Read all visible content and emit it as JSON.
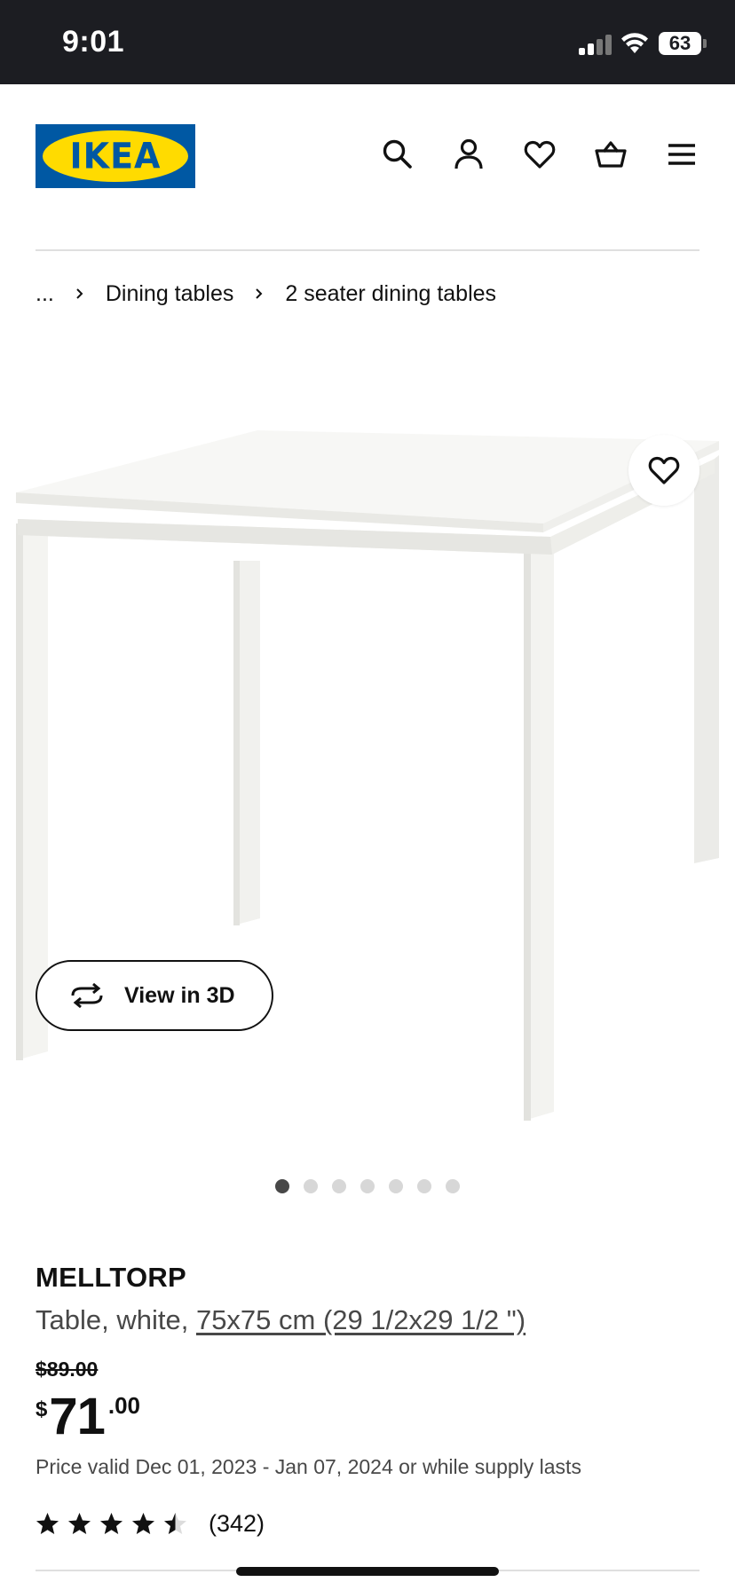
{
  "status_bar": {
    "time": "9:01",
    "battery": "63",
    "icons": [
      "cellular-signal-icon",
      "wifi-icon",
      "battery-icon"
    ]
  },
  "header": {
    "logo_text": "IKEA",
    "brand_colors": {
      "blue": "#0058a3",
      "yellow": "#ffdb00"
    },
    "icons": [
      "search-icon",
      "account-icon",
      "heart-icon",
      "shopping-bag-icon",
      "menu-icon"
    ]
  },
  "breadcrumb": {
    "items": [
      "...",
      "Dining tables",
      "2 seater dining tables"
    ],
    "separator_icon": "chevron-right-icon"
  },
  "gallery": {
    "view_3d_label": "View in 3D",
    "view_3d_icon": "rotate-3d-icon",
    "favorite_icon": "heart-icon",
    "image_count": 7,
    "active_index": 0
  },
  "product": {
    "name": "MELLTORP",
    "description": "Table, white,",
    "size": "75x75 cm (29 1/2x29 1/2 \")",
    "old_price": "$89.00",
    "price": {
      "currency": "$",
      "integer": "71",
      "decimal": ".00"
    },
    "price_valid": "Price valid Dec 01, 2023 - Jan 07, 2024 or while supply lasts",
    "rating": 4.5,
    "review_count": "(342)"
  }
}
